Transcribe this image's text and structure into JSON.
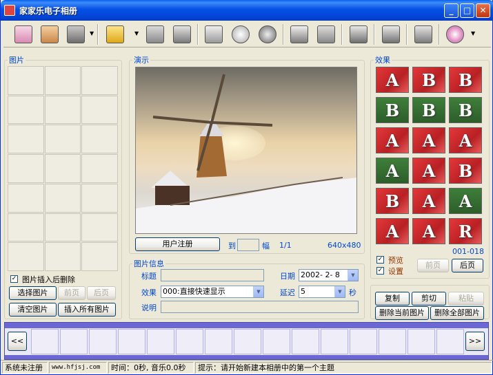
{
  "window": {
    "title": "家家乐电子相册"
  },
  "toolbar": {
    "tools": [
      "album-icon",
      "photo-album-icon",
      "save-icon",
      "new-document-icon",
      "print-icon",
      "edit-image-icon",
      "image-settings-icon",
      "cd-icon",
      "music-icon",
      "import-icon",
      "archive-icon",
      "export-icon",
      "burn-icon",
      "media-icon",
      "help-disc-icon"
    ]
  },
  "pictures": {
    "legend": "图片",
    "insert_delete_label": "图片插入后删除",
    "select_label": "选择图片",
    "prev_label": "前页",
    "next_label": "后页",
    "clear_label": "清空图片",
    "insert_all_label": "插入所有图片"
  },
  "demo": {
    "legend": "演示",
    "register_label": "用户注册",
    "to_label": "到",
    "page_field": "",
    "frame_label": "幅",
    "count": "1/1",
    "resolution": "640x480"
  },
  "info": {
    "legend": "图片信息",
    "title_label": "标题",
    "title_value": "",
    "date_label": "日期",
    "date_value": "2002- 2- 8",
    "effect_label": "效果",
    "effect_value": "000:直接快速显示",
    "delay_label": "延迟",
    "delay_value": "5",
    "delay_unit": "秒",
    "desc_label": "说明",
    "desc_value": ""
  },
  "effects": {
    "legend": "效果",
    "range": "001-018",
    "preview_label": "预览",
    "settings_label": "设置",
    "prev_label": "前页",
    "next_label": "后页",
    "tiles": [
      {
        "letter": "A",
        "bg": "red"
      },
      {
        "letter": "B",
        "bg": "red"
      },
      {
        "letter": "B",
        "bg": "red"
      },
      {
        "letter": "B",
        "bg": "green"
      },
      {
        "letter": "B",
        "bg": "green"
      },
      {
        "letter": "B",
        "bg": "green"
      },
      {
        "letter": "A",
        "bg": "red"
      },
      {
        "letter": "A",
        "bg": "red"
      },
      {
        "letter": "A",
        "bg": "red"
      },
      {
        "letter": "A",
        "bg": "green"
      },
      {
        "letter": "A",
        "bg": "red"
      },
      {
        "letter": "B",
        "bg": "red"
      },
      {
        "letter": "B",
        "bg": "red"
      },
      {
        "letter": "A",
        "bg": "red"
      },
      {
        "letter": "A",
        "bg": "green"
      },
      {
        "letter": "A",
        "bg": "red"
      },
      {
        "letter": "A",
        "bg": "red"
      },
      {
        "letter": "R",
        "bg": "red"
      }
    ]
  },
  "edit": {
    "copy_label": "复制",
    "cut_label": "剪切",
    "paste_label": "粘贴",
    "delete_current_label": "删除当前图片",
    "delete_all_label": "删除全部图片"
  },
  "filmstrip": {
    "left_label": "<<",
    "right_label": ">>"
  },
  "status": {
    "reg": "系统未注册",
    "url": "www.hfjsj.com",
    "time": "时间：0秒, 音乐0.0秒",
    "hint": "提示：请开始新建本相册中的第一个主题"
  }
}
